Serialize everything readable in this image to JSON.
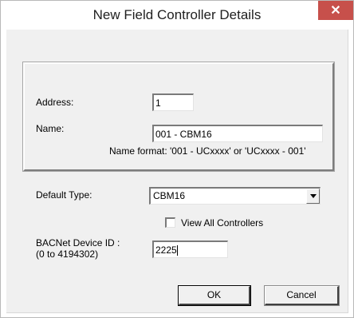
{
  "window": {
    "title": "New Field Controller Details",
    "close_glyph": "✕",
    "close_color": "#c7504b"
  },
  "group": {
    "address_label": "Address:",
    "address_value": "1",
    "name_label": "Name:",
    "name_value": "001 - CBM16",
    "name_format_hint": "Name format: '001 - UCxxxx' or 'UCxxxx - 001'"
  },
  "default_type": {
    "label": "Default Type:",
    "selected": "CBM16",
    "arrow_icon": "chevron-down-icon"
  },
  "view_all": {
    "label": "View All Controllers",
    "checked": false
  },
  "bacnet": {
    "label_line1": "BACNet Device ID :",
    "label_line2": "(0 to 4194302)",
    "value": "2225"
  },
  "buttons": {
    "ok": "OK",
    "cancel": "Cancel"
  }
}
